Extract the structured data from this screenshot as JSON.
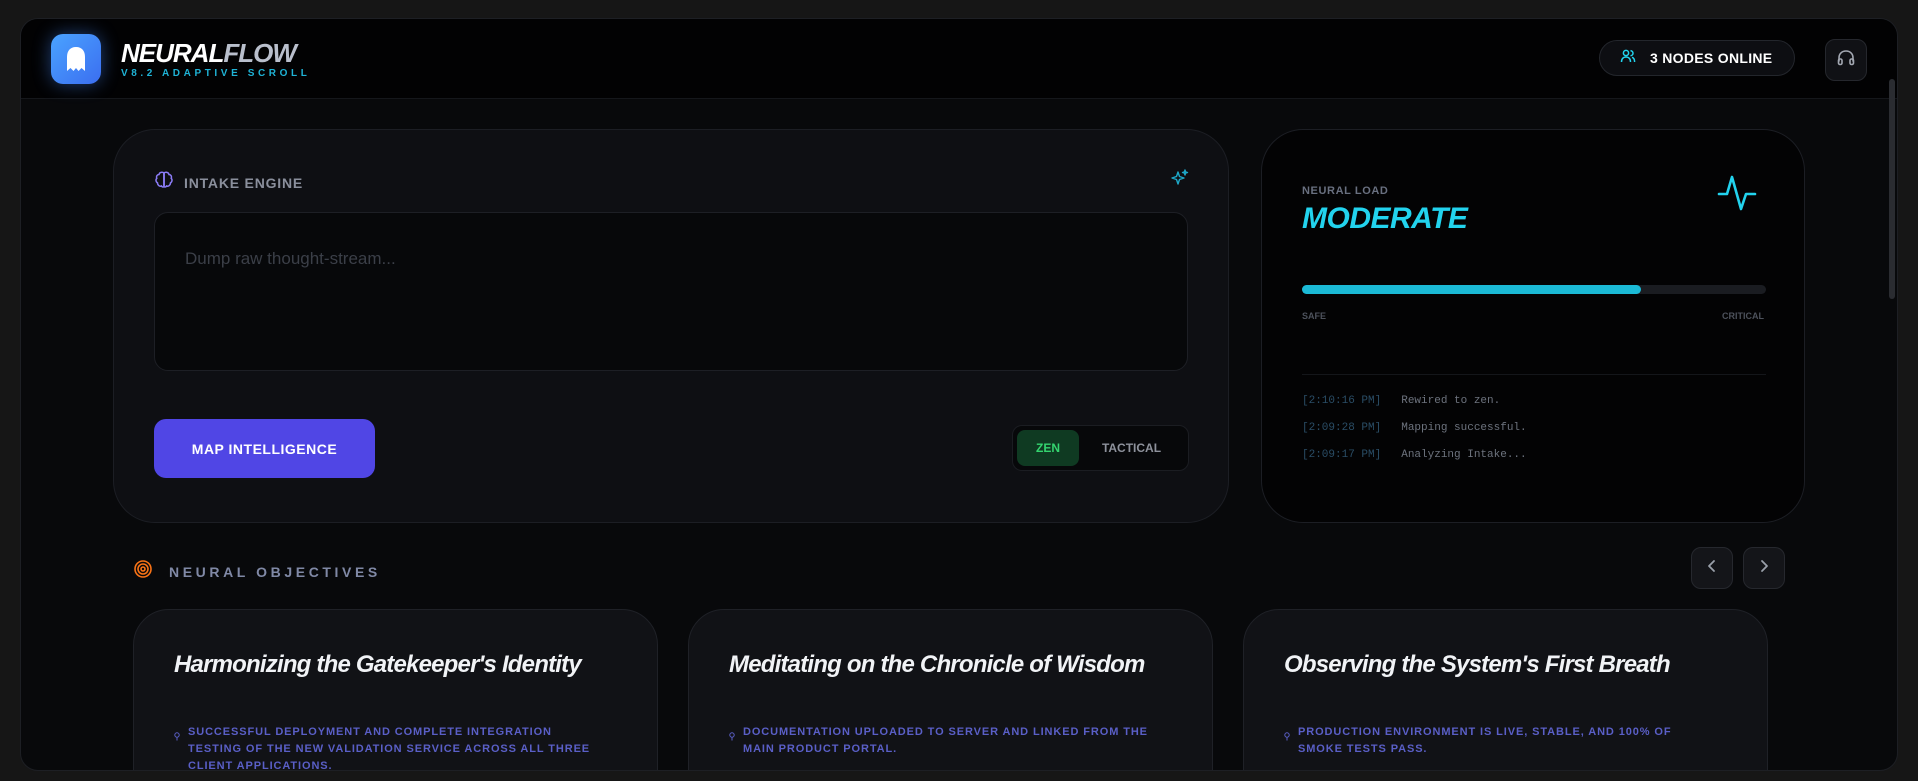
{
  "header": {
    "brand_main": "NEURAL",
    "brand_accent": "FLOW",
    "subtitle": "V8.2 ADAPTIVE SCROLL",
    "nodes_online": "3 NODES ONLINE",
    "icons": {
      "logo": "ghost-icon",
      "nodes": "users-icon",
      "audio": "headphones-icon"
    }
  },
  "intake": {
    "label": "INTAKE ENGINE",
    "placeholder": "Dump raw thought-stream...",
    "value": "",
    "map_button": "MAP INTELLIGENCE",
    "modes": [
      "ZEN",
      "TACTICAL"
    ],
    "active_mode": "ZEN",
    "icons": {
      "label": "brain-icon",
      "corner": "sparkles-icon"
    }
  },
  "neural_load": {
    "label": "NEURAL LOAD",
    "status": "MODERATE",
    "progress": 0.73,
    "scale_min": "SAFE",
    "scale_max": "CRITICAL",
    "logs": [
      {
        "time": "[2:10:16 PM]",
        "message": "Rewired to zen."
      },
      {
        "time": "[2:09:28 PM]",
        "message": "Mapping successful."
      },
      {
        "time": "[2:09:17 PM]",
        "message": "Analyzing Intake..."
      }
    ],
    "icons": {
      "status": "activity-pulse-icon"
    }
  },
  "objectives": {
    "label": "NEURAL OBJECTIVES",
    "cards": [
      {
        "title": "Harmonizing the Gatekeeper's Identity",
        "description": "SUCCESSFUL DEPLOYMENT AND COMPLETE INTEGRATION TESTING OF THE NEW VALIDATION SERVICE ACROSS ALL THREE CLIENT APPLICATIONS."
      },
      {
        "title": "Meditating on the Chronicle of Wisdom",
        "description": "DOCUMENTATION UPLOADED TO SERVER AND LINKED FROM THE MAIN PRODUCT PORTAL."
      },
      {
        "title": "Observing the System's First Breath",
        "description": "PRODUCTION ENVIRONMENT IS LIVE, STABLE, AND 100% OF SMOKE TESTS PASS."
      }
    ],
    "icons": {
      "label": "target-icon",
      "prev": "chevron-left-icon",
      "next": "chevron-right-icon",
      "card": "pin-icon"
    }
  },
  "colors": {
    "accent_cyan": "#22d3ee",
    "accent_indigo": "#5046e5",
    "zen_green": "#34d46f",
    "target_orange": "#f97316"
  }
}
